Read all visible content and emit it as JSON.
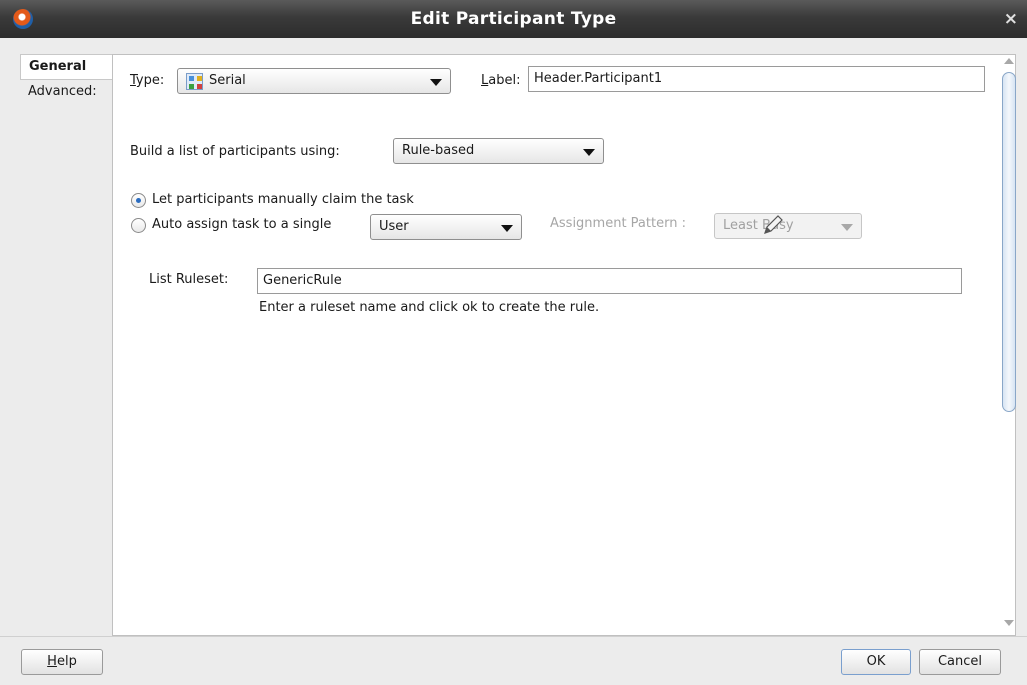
{
  "window": {
    "title": "Edit Participant Type",
    "close_glyph": "×",
    "app_icon": "oracle-jdeveloper-icon"
  },
  "sidebar": {
    "items": [
      {
        "label": "General",
        "active": true
      },
      {
        "label": "Advanced:",
        "active": false
      }
    ]
  },
  "form": {
    "type_label_mnemonic": "T",
    "type_label_rest": "ype:",
    "type_value": "Serial",
    "type_icon": "serial-participant-icon",
    "label_field_mnemonic": "L",
    "label_field_rest": "abel:",
    "label_value": "Header.Participant1",
    "build_list_label": "Build a list of participants using:",
    "build_list_value": "Rule-based",
    "radio_manual_label": "Let participants manually claim the task",
    "radio_manual_checked": true,
    "radio_auto_label": "Auto assign task to a single",
    "radio_auto_checked": false,
    "auto_assign_value": "User",
    "assignment_pattern_label": "Assignment Pattern :",
    "assignment_pattern_value": "Least Busy",
    "list_ruleset_label": "List Ruleset:",
    "list_ruleset_value": "GenericRule",
    "ruleset_hint": "Enter a ruleset name and click ok to create the rule."
  },
  "buttons": {
    "help_mnemonic": "H",
    "help_rest": "elp",
    "ok_label": "OK",
    "cancel_label": "Cancel"
  },
  "colors": {
    "titlebar": "#3a3a3a",
    "accent": "#2a6cc0"
  }
}
